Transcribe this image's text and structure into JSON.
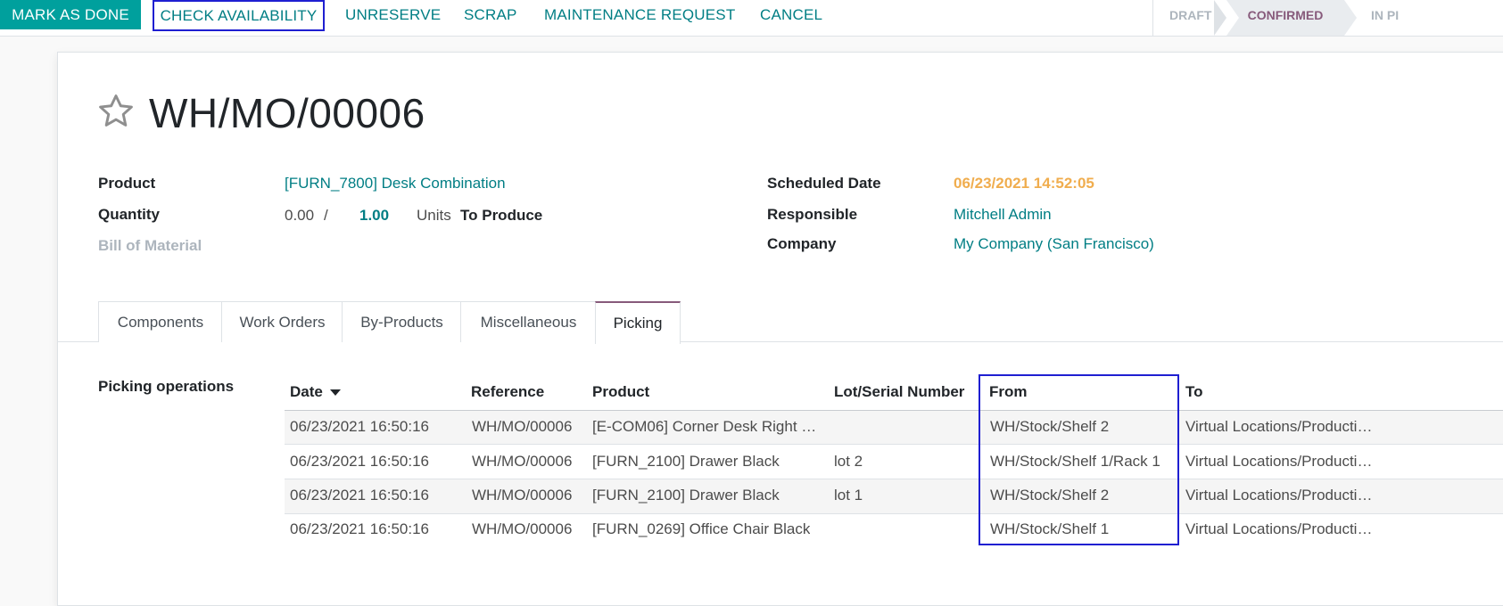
{
  "toolbar": {
    "mark_done": "MARK AS DONE",
    "check_availability": "CHECK AVAILABILITY",
    "unreserve": "UNRESERVE",
    "scrap": "SCRAP",
    "maintenance_request": "MAINTENANCE REQUEST",
    "cancel": "CANCEL"
  },
  "status": {
    "draft": "DRAFT",
    "confirmed": "CONFIRMED",
    "in_progress": "IN PI"
  },
  "record": {
    "title": "WH/MO/00006",
    "product_label": "Product",
    "product_value": "[FURN_7800] Desk Combination",
    "quantity_label": "Quantity",
    "quantity_produced": "0.00",
    "quantity_sep": "/",
    "quantity_planned": "1.00",
    "quantity_uom": "Units",
    "quantity_suffix": "To Produce",
    "bom_label": "Bill of Material",
    "scheduled_label": "Scheduled Date",
    "scheduled_value": "06/23/2021 14:52:05",
    "responsible_label": "Responsible",
    "responsible_value": "Mitchell Admin",
    "company_label": "Company",
    "company_value": "My Company (San Francisco)"
  },
  "tabs": [
    "Components",
    "Work Orders",
    "By-Products",
    "Miscellaneous",
    "Picking"
  ],
  "picking": {
    "section_label": "Picking operations",
    "columns": [
      "Date",
      "Reference",
      "Product",
      "Lot/Serial Number",
      "From",
      "To"
    ],
    "rows": [
      [
        "06/23/2021 16:50:16",
        "WH/MO/00006",
        "[E-COM06] Corner Desk Right …",
        "",
        "WH/Stock/Shelf 2",
        "Virtual Locations/Producti…"
      ],
      [
        "06/23/2021 16:50:16",
        "WH/MO/00006",
        "[FURN_2100] Drawer Black",
        "lot 2",
        "WH/Stock/Shelf 1/Rack 1",
        "Virtual Locations/Producti…"
      ],
      [
        "06/23/2021 16:50:16",
        "WH/MO/00006",
        "[FURN_2100] Drawer Black",
        "lot 1",
        "WH/Stock/Shelf 2",
        "Virtual Locations/Producti…"
      ],
      [
        "06/23/2021 16:50:16",
        "WH/MO/00006",
        "[FURN_0269] Office Chair Black",
        "",
        "WH/Stock/Shelf 1",
        "Virtual Locations/Producti…"
      ]
    ]
  },
  "colors": {
    "primary": "#00a09d",
    "link": "#017e84",
    "highlight": "#1f1fd1",
    "warning": "#f0ad4e",
    "stage_active": "#875a7b"
  }
}
